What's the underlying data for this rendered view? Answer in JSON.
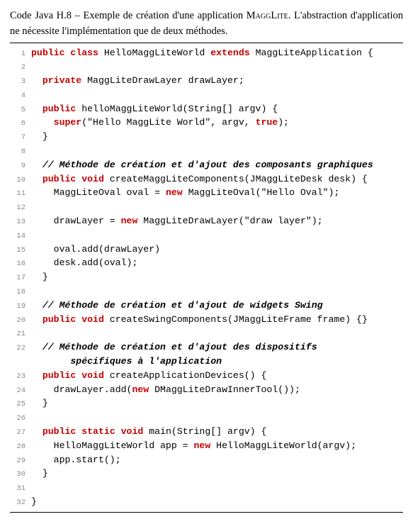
{
  "caption_parts": {
    "prefix": "Code Java H.8 – Exemple de création d'une application ",
    "sc": "MaggLite",
    "rest": ". L'abstraction d'application ne nécessite l'implémentation que de deux méthodes."
  },
  "code_lines": [
    {
      "n": "1",
      "tokens": [
        {
          "t": "kw",
          "v": "public"
        },
        {
          "t": "p",
          "v": " "
        },
        {
          "t": "kw",
          "v": "class"
        },
        {
          "t": "p",
          "v": " HelloMaggLiteWorld "
        },
        {
          "t": "kw",
          "v": "extends"
        },
        {
          "t": "p",
          "v": " MaggLiteApplication {"
        }
      ]
    },
    {
      "n": "2",
      "tokens": []
    },
    {
      "n": "3",
      "tokens": [
        {
          "t": "p",
          "v": "  "
        },
        {
          "t": "kw",
          "v": "private"
        },
        {
          "t": "p",
          "v": " MaggLiteDrawLayer drawLayer;"
        }
      ]
    },
    {
      "n": "4",
      "tokens": []
    },
    {
      "n": "5",
      "tokens": [
        {
          "t": "p",
          "v": "  "
        },
        {
          "t": "kw",
          "v": "public"
        },
        {
          "t": "p",
          "v": " helloMaggLiteWorld(String[] argv) {"
        }
      ]
    },
    {
      "n": "6",
      "tokens": [
        {
          "t": "p",
          "v": "    "
        },
        {
          "t": "kw",
          "v": "super"
        },
        {
          "t": "p",
          "v": "(\"Hello MaggLite World\", argv, "
        },
        {
          "t": "kw",
          "v": "true"
        },
        {
          "t": "p",
          "v": ");"
        }
      ]
    },
    {
      "n": "7",
      "tokens": [
        {
          "t": "p",
          "v": "  }"
        }
      ]
    },
    {
      "n": "8",
      "tokens": []
    },
    {
      "n": "9",
      "tokens": [
        {
          "t": "p",
          "v": "  "
        },
        {
          "t": "cm",
          "v": "// Méthode de création et d'ajout des composants graphiques"
        }
      ]
    },
    {
      "n": "10",
      "tokens": [
        {
          "t": "p",
          "v": "  "
        },
        {
          "t": "kw",
          "v": "public"
        },
        {
          "t": "p",
          "v": " "
        },
        {
          "t": "kw",
          "v": "void"
        },
        {
          "t": "p",
          "v": " createMaggLiteComponents(JMaggLiteDesk desk) {"
        }
      ]
    },
    {
      "n": "11",
      "tokens": [
        {
          "t": "p",
          "v": "    MaggLiteOval oval = "
        },
        {
          "t": "kw",
          "v": "new"
        },
        {
          "t": "p",
          "v": " MaggLiteOval(\"Hello Oval\");"
        }
      ]
    },
    {
      "n": "12",
      "tokens": []
    },
    {
      "n": "13",
      "tokens": [
        {
          "t": "p",
          "v": "    drawLayer = "
        },
        {
          "t": "kw",
          "v": "new"
        },
        {
          "t": "p",
          "v": " MaggLiteDrawLayer(\"draw layer\");"
        }
      ]
    },
    {
      "n": "14",
      "tokens": []
    },
    {
      "n": "15",
      "tokens": [
        {
          "t": "p",
          "v": "    oval.add(drawLayer)"
        }
      ]
    },
    {
      "n": "16",
      "tokens": [
        {
          "t": "p",
          "v": "    desk.add(oval);"
        }
      ]
    },
    {
      "n": "17",
      "tokens": [
        {
          "t": "p",
          "v": "  }"
        }
      ]
    },
    {
      "n": "18",
      "tokens": []
    },
    {
      "n": "19",
      "tokens": [
        {
          "t": "p",
          "v": "  "
        },
        {
          "t": "cm",
          "v": "// Méthode de création et d'ajout de widgets Swing"
        }
      ]
    },
    {
      "n": "20",
      "tokens": [
        {
          "t": "p",
          "v": "  "
        },
        {
          "t": "kw",
          "v": "public"
        },
        {
          "t": "p",
          "v": " "
        },
        {
          "t": "kw",
          "v": "void"
        },
        {
          "t": "p",
          "v": " createSwingComponents(JMaggLiteFrame frame) {}"
        }
      ]
    },
    {
      "n": "21",
      "tokens": []
    },
    {
      "n": "22",
      "tokens": [
        {
          "t": "p",
          "v": "  "
        },
        {
          "t": "cm",
          "v": "// Méthode de création et d'ajout des dispositifs\n       spécifiques à l'application"
        }
      ]
    },
    {
      "n": "23",
      "tokens": [
        {
          "t": "p",
          "v": "  "
        },
        {
          "t": "kw",
          "v": "public"
        },
        {
          "t": "p",
          "v": " "
        },
        {
          "t": "kw",
          "v": "void"
        },
        {
          "t": "p",
          "v": " createApplicationDevices() {"
        }
      ]
    },
    {
      "n": "24",
      "tokens": [
        {
          "t": "p",
          "v": "    drawLayer.add("
        },
        {
          "t": "kw",
          "v": "new"
        },
        {
          "t": "p",
          "v": " DMaggLiteDrawInnerTool());"
        }
      ]
    },
    {
      "n": "25",
      "tokens": [
        {
          "t": "p",
          "v": "  }"
        }
      ]
    },
    {
      "n": "26",
      "tokens": []
    },
    {
      "n": "27",
      "tokens": [
        {
          "t": "p",
          "v": "  "
        },
        {
          "t": "kw",
          "v": "public"
        },
        {
          "t": "p",
          "v": " "
        },
        {
          "t": "kw",
          "v": "static"
        },
        {
          "t": "p",
          "v": " "
        },
        {
          "t": "kw",
          "v": "void"
        },
        {
          "t": "p",
          "v": " main(String[] argv) {"
        }
      ]
    },
    {
      "n": "28",
      "tokens": [
        {
          "t": "p",
          "v": "    HelloMaggLiteWorld app = "
        },
        {
          "t": "kw",
          "v": "new"
        },
        {
          "t": "p",
          "v": " HelloMaggLiteWorld(argv);"
        }
      ]
    },
    {
      "n": "29",
      "tokens": [
        {
          "t": "p",
          "v": "    app.start();"
        }
      ]
    },
    {
      "n": "30",
      "tokens": [
        {
          "t": "p",
          "v": "  }"
        }
      ]
    },
    {
      "n": "31",
      "tokens": []
    },
    {
      "n": "32",
      "tokens": [
        {
          "t": "p",
          "v": "}"
        }
      ]
    }
  ]
}
